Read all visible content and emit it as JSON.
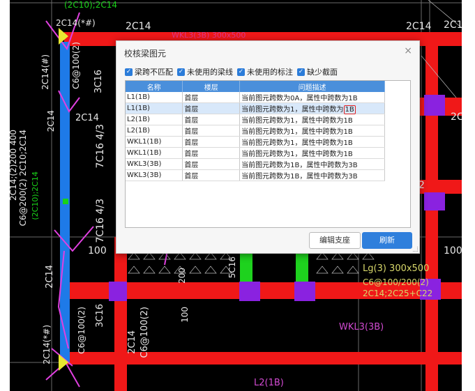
{
  "dialog": {
    "title": "校核梁图元",
    "close": "×",
    "filters": [
      {
        "label": "梁跨不匹配",
        "checked": true
      },
      {
        "label": "未使用的梁线",
        "checked": true
      },
      {
        "label": "未使用的标注",
        "checked": true
      },
      {
        "label": "缺少截面",
        "checked": true
      }
    ],
    "columns": [
      "名称",
      "楼层",
      "问题描述"
    ],
    "rows": [
      {
        "name": "L1(1B)",
        "floor": "首层",
        "desc": "当前图元跨数为0A，属性中跨数为1B"
      },
      {
        "name": "L1(1B)",
        "floor": "首层",
        "desc": "当前图元跨数为1，属性中跨数为1B",
        "selected": true
      },
      {
        "name": "L2(1B)",
        "floor": "首层",
        "desc": "当前图元跨数为1，属性中跨数为1B"
      },
      {
        "name": "L2(1B)",
        "floor": "首层",
        "desc": "当前图元跨数为1，属性中跨数为1B"
      },
      {
        "name": "WKL1(1B)",
        "floor": "首层",
        "desc": "当前图元跨数为1，属性中跨数为1B"
      },
      {
        "name": "WKL1(1B)",
        "floor": "首层",
        "desc": "当前图元跨数为1，属性中跨数为1B"
      },
      {
        "name": "WKL3(3B)",
        "floor": "首层",
        "desc": "当前图元跨数为1B，属性中跨数为3B"
      },
      {
        "name": "WKL3(3B)",
        "floor": "首层",
        "desc": "当前图元跨数为1B，属性中跨数为3B"
      }
    ],
    "buttons": {
      "edit": "编辑支座",
      "refresh": "刷新"
    }
  },
  "cad_labels": {
    "top_rebar": "(2C10);2C14",
    "top_2c14_a": "2C14(*#)",
    "top_2c14_b": "2C14",
    "top_2c14_c": "2C14",
    "top_2c1": "2C1",
    "top_faded": "WKL3(3B) 300x500",
    "left_2c14_1": "2C14(#)",
    "left_c6": "C6@100(2)",
    "left_3c16": "3C16",
    "left_2c14_2": "2C14",
    "left_2c14_3": "2C14",
    "left_7c16": "7C16 4/3",
    "left_7c16_b": "7C16 4/3",
    "far_left_1": "C6@200(2) 2C10;2C14",
    "far_left_2": "(2C10);2C14",
    "far_left_3": "2C14;(2)200 400",
    "right_2c": "2C",
    "mid_100": "100",
    "mid_200": "200",
    "mid_5c16": "5C16",
    "right_100": "100",
    "right_2": "2",
    "lower_left_2c14": "2C14",
    "lower_3c16": "3C16",
    "lower_c6": "C6@100(2)",
    "lower_2c14_b": "2C14(*#)",
    "lower_c6_b": "C6@100(2)",
    "lower_2c14_c": "2C14",
    "lower_100": "100",
    "lg": "Lg(3) 300x500",
    "lg_r1": "C6@100/200(2)",
    "lg_r2": "2C14;2C25+C22",
    "wkl3": "WKL3(3B)",
    "l2": "L2(1B)"
  },
  "colors": {
    "beam_red": "#f01818",
    "column_purple": "#8a22e0",
    "blue_beam": "#1e7ae8",
    "green_beam": "#1ed21e",
    "accent": "#2f7fdc",
    "highlight": "#e02020"
  }
}
